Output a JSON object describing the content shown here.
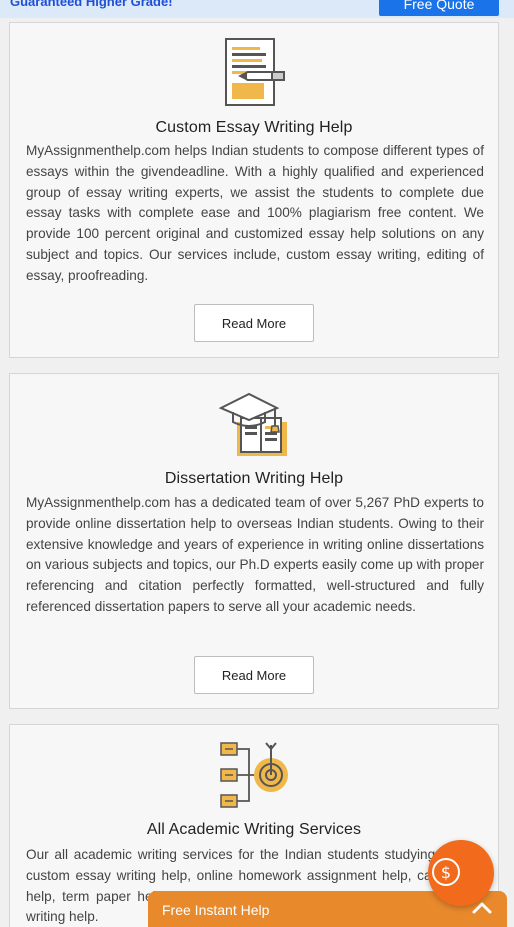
{
  "topbar": {
    "promo": "Guaranteed Higher Grade!",
    "quote_button": "Free Quote"
  },
  "cards": [
    {
      "icon": "essay-document-pen-icon",
      "title": "Custom Essay Writing Help",
      "body": "MyAssignmenthelp.com helps Indian students to compose different types of essays within the givendeadline. With a highly qualified and experienced group of essay writing experts, we assist the students to complete due essay tasks with complete ease and 100% plagiarism free content. We provide 100 percent original and customized essay help solutions on any subject and topics. Our services include, custom essay writing, editing of essay, proofreading.",
      "button": "Read More"
    },
    {
      "icon": "graduation-cap-books-icon",
      "title": "Dissertation Writing Help",
      "body": "MyAssignmenthelp.com has a dedicated team of over 5,267 PhD experts to provide online dissertation help to overseas Indian students. Owing to their extensive knowledge and years of experience in writing online dissertations on various subjects and topics, our Ph.D experts easily come up with proper referencing and citation perfectly formatted, well-structured and fully referenced dissertation papers to serve all your academic needs.",
      "button": "Read More"
    },
    {
      "icon": "target-flowchart-icon",
      "title": "All Academic Writing Services",
      "body": "Our all academic writing services for the Indian students studying include custom essay writing help, online homework assignment help, case study help, term paper help, coursework help, thesis help and research paper writing help."
    }
  ],
  "help_bar": {
    "label": "Free Instant Help",
    "icon": "chevron-up-icon"
  },
  "fab": {
    "icon": "dollar-icon"
  },
  "colors": {
    "accent_orange": "#e8892b",
    "fab_orange": "#f26a1b",
    "icon_gold": "#f0b84a",
    "icon_dark": "#555555",
    "link_blue": "#1a73e8"
  }
}
